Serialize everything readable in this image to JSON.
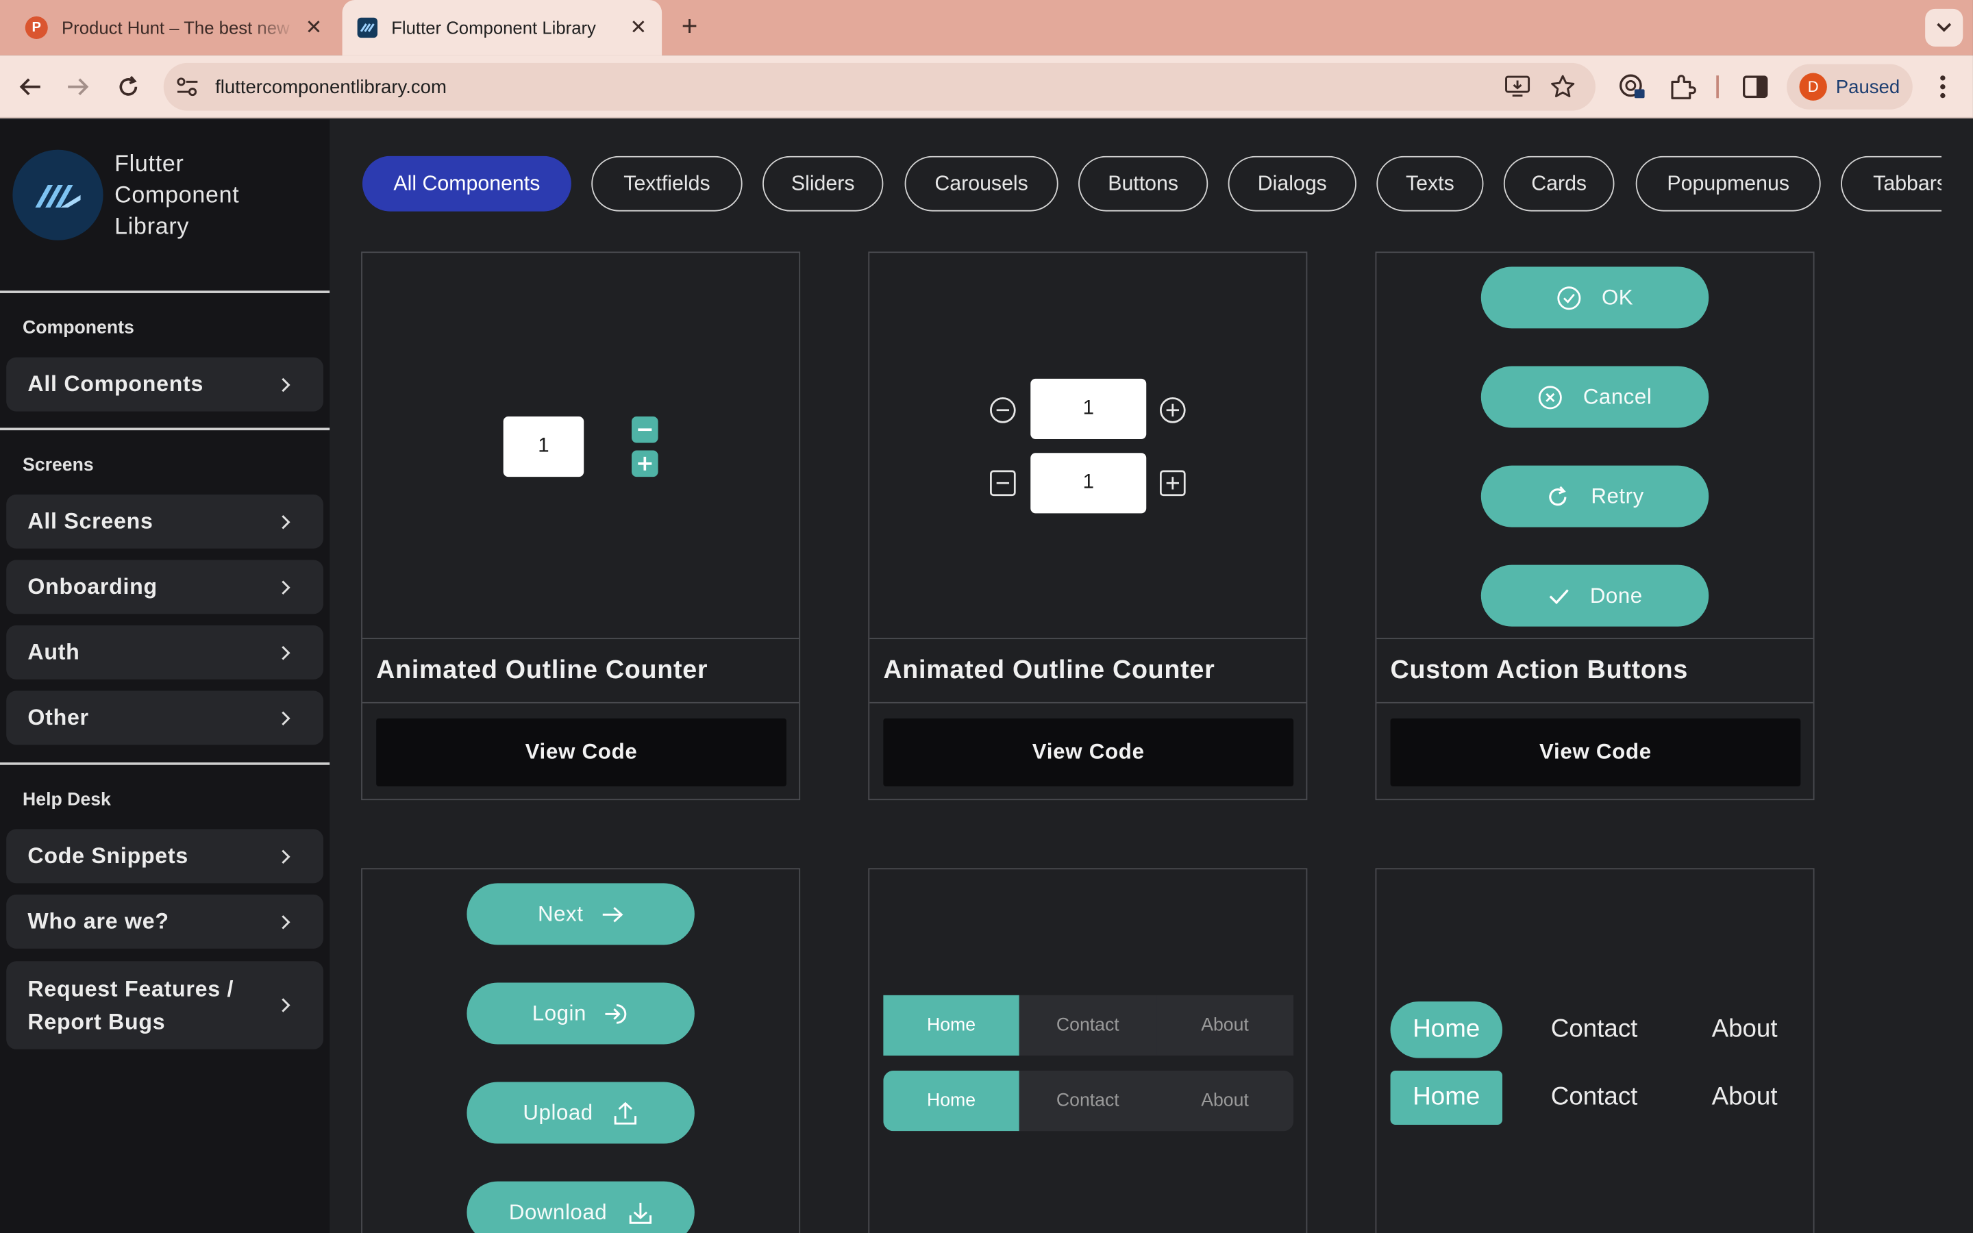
{
  "browser": {
    "tabs": [
      {
        "title": "Product Hunt – The best new products in tech.",
        "favicon": "product-hunt-icon",
        "active": false
      },
      {
        "title": "Flutter Component Library",
        "favicon": "flutter-library-icon",
        "active": true
      }
    ],
    "url": "fluttercomponentlibrary.com",
    "profile_initial": "D",
    "profile_status": "Paused"
  },
  "sidebar": {
    "brand": "Flutter Component Library",
    "sections": [
      {
        "heading": "Components",
        "items": [
          "All Components"
        ]
      },
      {
        "heading": "Screens",
        "items": [
          "All Screens",
          "Onboarding",
          "Auth",
          "Other"
        ]
      },
      {
        "heading": "Help Desk",
        "items": [
          "Code Snippets",
          "Who are we?",
          "Request Features / Report Bugs"
        ]
      }
    ]
  },
  "filters": [
    "All Components",
    "Textfields",
    "Sliders",
    "Carousels",
    "Buttons",
    "Dialogs",
    "Texts",
    "Cards",
    "Popupmenus",
    "Tabbars"
  ],
  "selected_filter": "All Components",
  "cards": [
    {
      "title": "Animated Outline Counter",
      "action": "View Code",
      "counter_value": "1"
    },
    {
      "title": "Animated Outline Counter",
      "action": "View Code",
      "counter_values": [
        "1",
        "1"
      ]
    },
    {
      "title": "Custom Action Buttons",
      "action": "View Code",
      "buttons": [
        "OK",
        "Cancel",
        "Retry",
        "Done"
      ]
    },
    {
      "buttons": [
        "Next",
        "Login",
        "Upload",
        "Download"
      ]
    },
    {
      "segments": [
        "Home",
        "Contact",
        "About"
      ]
    },
    {
      "nav_items": [
        "Home",
        "Contact",
        "About"
      ]
    }
  ],
  "colors": {
    "accent_teal": "#55b8ab",
    "chip_selected": "#2c3bb0",
    "page_bg": "#1f2023",
    "sidebar_bg": "#151518",
    "tabstrip": "#e3a99a"
  }
}
